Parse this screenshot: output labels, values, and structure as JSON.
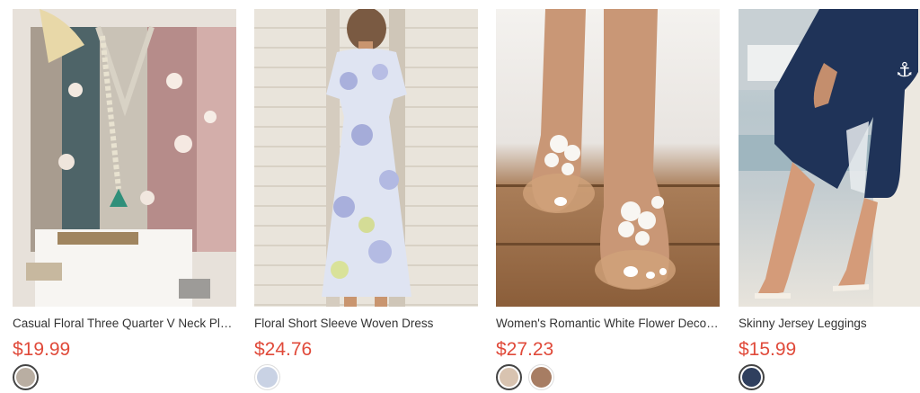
{
  "products": [
    {
      "title": "Casual Floral Three Quarter V Neck Plus Size Blouse",
      "price": "$19.99",
      "swatches": [
        {
          "color": "#b9aea2",
          "selected": true
        }
      ]
    },
    {
      "title": "Floral Short Sleeve Woven Dress",
      "price": "$24.76",
      "swatches": [
        {
          "color": "#c9d2e4",
          "selected": true
        }
      ]
    },
    {
      "title": "Women's Romantic White Flower Decorative Sandals",
      "price": "$27.23",
      "swatches": [
        {
          "color": "#d8c3b0",
          "selected": true
        },
        {
          "color": "#a77d63",
          "selected": false
        }
      ]
    },
    {
      "title": "Skinny Jersey Leggings",
      "price": "$15.99",
      "swatches": [
        {
          "color": "#2f3f5e",
          "selected": true
        }
      ]
    }
  ]
}
